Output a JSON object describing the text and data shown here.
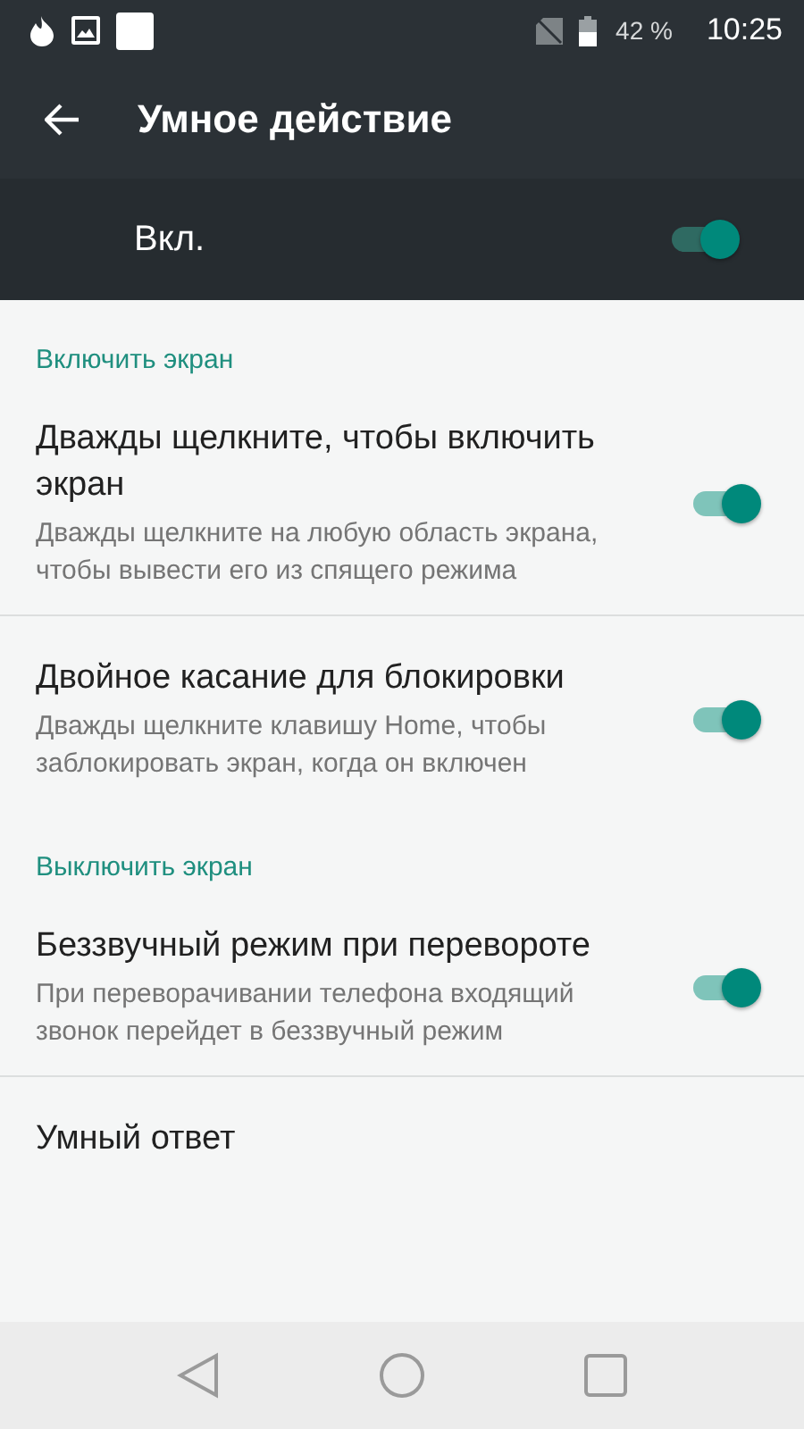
{
  "status_bar": {
    "battery": "42 %",
    "time": "10:25"
  },
  "toolbar": {
    "title": "Умное действие"
  },
  "master": {
    "label": "Вкл.",
    "on": true
  },
  "sections": [
    {
      "header": "Включить экран",
      "items": [
        {
          "title": "Дважды щелкните, чтобы включить экран",
          "summary": "Дважды щелкните на любую область экрана, чтобы вывести его из спящего режима",
          "on": true
        },
        {
          "title": "Двойное касание для блокировки",
          "summary": "Дважды щелкните клавишу Home, чтобы заблокировать экран, когда он включен",
          "on": true
        }
      ]
    },
    {
      "header": "Выключить экран",
      "items": [
        {
          "title": "Беззвучный режим при перевороте",
          "summary": "При переворачивании телефона входящий звонок перейдет в беззвучный режим",
          "on": true
        },
        {
          "title": "Умный ответ"
        }
      ]
    }
  ]
}
